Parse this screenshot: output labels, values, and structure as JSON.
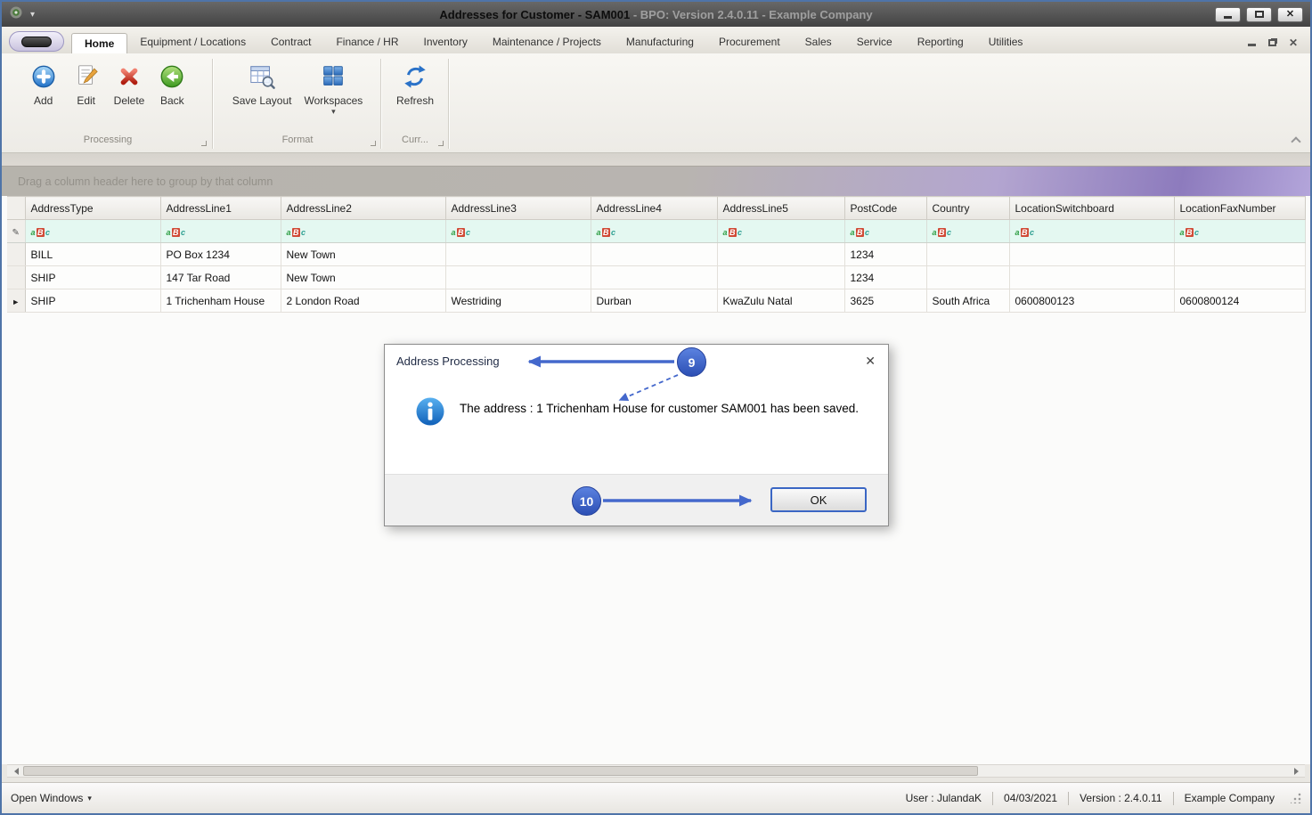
{
  "window": {
    "title_main": "Addresses for Customer - SAM001",
    "title_suffix": " - BPO: Version 2.4.0.11 - Example Company"
  },
  "tabs": [
    "Home",
    "Equipment / Locations",
    "Contract",
    "Finance / HR",
    "Inventory",
    "Maintenance / Projects",
    "Manufacturing",
    "Procurement",
    "Sales",
    "Service",
    "Reporting",
    "Utilities"
  ],
  "ribbon": {
    "groups": [
      {
        "caption": "Processing",
        "buttons": [
          {
            "label": "Add"
          },
          {
            "label": "Edit"
          },
          {
            "label": "Delete"
          },
          {
            "label": "Back"
          }
        ]
      },
      {
        "caption": "Format",
        "buttons": [
          {
            "label": "Save Layout"
          },
          {
            "label": "Workspaces",
            "has_dropdown": true
          }
        ]
      },
      {
        "caption": "Curr...",
        "buttons": [
          {
            "label": "Refresh"
          }
        ]
      }
    ]
  },
  "grid": {
    "group_hint": "Drag a column header here to group by that column",
    "filter_icon": "aBc",
    "columns": [
      "AddressType",
      "AddressLine1",
      "AddressLine2",
      "AddressLine3",
      "AddressLine4",
      "AddressLine5",
      "PostCode",
      "Country",
      "LocationSwitchboard",
      "LocationFaxNumber"
    ],
    "rows": [
      {
        "selected": false,
        "cells": [
          "BILL",
          "PO Box 1234",
          "New Town",
          "",
          "",
          "",
          "1234",
          "",
          "",
          ""
        ]
      },
      {
        "selected": false,
        "cells": [
          "SHIP",
          "147 Tar Road",
          "New Town",
          "",
          "",
          "",
          "1234",
          "",
          "",
          ""
        ]
      },
      {
        "selected": true,
        "cells": [
          "SHIP",
          "1 Trichenham House",
          "2 London Road",
          "Westriding",
          "Durban",
          "KwaZulu Natal",
          "3625",
          "South Africa",
          "0600800123",
          "0600800124"
        ]
      }
    ]
  },
  "dialog": {
    "title": "Address Processing",
    "message": "The address : 1 Trichenham House for customer SAM001 has been saved.",
    "ok_label": "OK"
  },
  "callouts": [
    {
      "label": "9"
    },
    {
      "label": "10"
    }
  ],
  "statusbar": {
    "open_windows": "Open Windows",
    "user": "User : JulandaK",
    "date": "04/03/2021",
    "version": "Version : 2.4.0.11",
    "company": "Example Company"
  },
  "colors": {
    "accent_blue": "#4468cc",
    "window_border": "#4f74a8",
    "filter_row": "#e4f8f1",
    "groupbar_purple": "#8d7bbd"
  },
  "icons": {
    "caret_down": "▾",
    "close_x": "✕",
    "row_indicator": "►",
    "filter_edit": "✎"
  }
}
